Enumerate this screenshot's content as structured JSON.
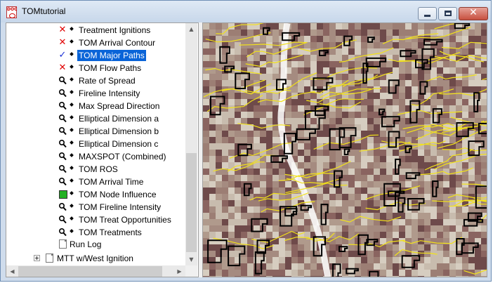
{
  "window": {
    "title": "TOMtutorial",
    "app_icon_text": "DOC"
  },
  "title_buttons": {
    "minimize": "minimize-button",
    "maximize": "maximize-button",
    "close": "close-button"
  },
  "tree": {
    "items": [
      {
        "label": "Treatment Ignitions",
        "state": "x",
        "icon": "red-x-icon"
      },
      {
        "label": "TOM Arrival Contour",
        "state": "x",
        "icon": "red-x-icon"
      },
      {
        "label": "TOM Major Paths",
        "state": "check",
        "icon": "blue-check-icon",
        "selected": true
      },
      {
        "label": "TOM Flow Paths",
        "state": "x",
        "icon": "red-x-icon"
      },
      {
        "label": "Rate of Spread",
        "state": "mag",
        "icon": "magnifier-icon"
      },
      {
        "label": "Fireline Intensity",
        "state": "mag",
        "icon": "magnifier-icon"
      },
      {
        "label": "Max Spread Direction",
        "state": "mag",
        "icon": "magnifier-icon"
      },
      {
        "label": "Elliptical Dimension a",
        "state": "mag",
        "icon": "magnifier-icon"
      },
      {
        "label": "Elliptical Dimension b",
        "state": "mag",
        "icon": "magnifier-icon"
      },
      {
        "label": "Elliptical Dimension c",
        "state": "mag",
        "icon": "magnifier-icon"
      },
      {
        "label": "MAXSPOT (Combined)",
        "state": "mag",
        "icon": "magnifier-icon"
      },
      {
        "label": "TOM ROS",
        "state": "mag",
        "icon": "magnifier-icon"
      },
      {
        "label": "TOM Arrival Time",
        "state": "mag",
        "icon": "magnifier-icon"
      },
      {
        "label": "TOM Node Influence",
        "state": "green",
        "icon": "green-square-icon"
      },
      {
        "label": "TOM Fireline Intensity",
        "state": "mag",
        "icon": "magnifier-icon"
      },
      {
        "label": "TOM Treat Opportunities",
        "state": "mag",
        "icon": "magnifier-icon"
      },
      {
        "label": "TOM Treatments",
        "state": "mag",
        "icon": "magnifier-icon"
      }
    ],
    "run_log": "Run Log",
    "other_node": "MTT w/West Ignition"
  },
  "colors": {
    "selection": "#0a64d8",
    "red_x": "#e00000",
    "check_blue": "#1a2fd6",
    "node_green": "#22b022",
    "map_base": "#b7a99a",
    "map_dark": "#6e4a4a",
    "flow_yellow": "#f2e21a",
    "contour_black": "#000000"
  }
}
